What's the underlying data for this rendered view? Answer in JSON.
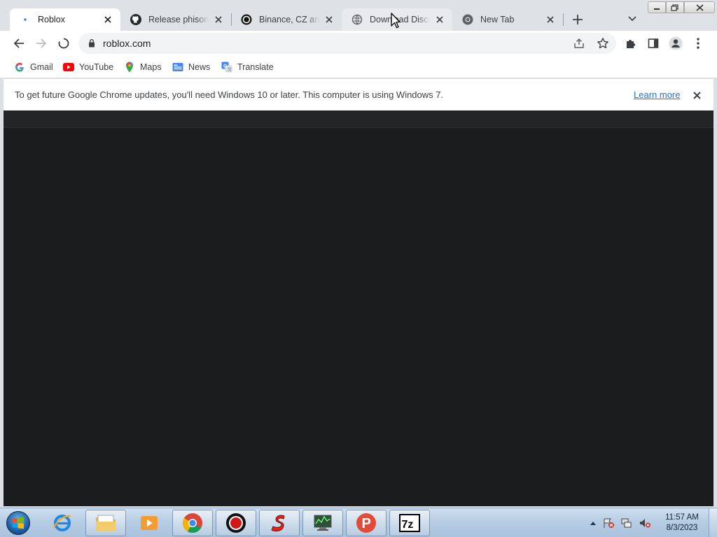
{
  "tabs": [
    {
      "title": "Roblox",
      "favicon": "loading-dot-icon",
      "active": true
    },
    {
      "title": "Release phison · T",
      "favicon": "github-icon",
      "active": false
    },
    {
      "title": "Binance, CZ and e",
      "favicon": "circle-logo-icon",
      "active": false
    },
    {
      "title": "Download Discord",
      "favicon": "globe-icon",
      "active": false
    },
    {
      "title": "New Tab",
      "favicon": "chrome-icon",
      "active": false
    }
  ],
  "toolbar": {
    "url": "roblox.com"
  },
  "bookmarks": [
    {
      "label": "Gmail",
      "icon": "google-icon"
    },
    {
      "label": "YouTube",
      "icon": "youtube-icon"
    },
    {
      "label": "Maps",
      "icon": "maps-icon"
    },
    {
      "label": "News",
      "icon": "news-icon"
    },
    {
      "label": "Translate",
      "icon": "translate-icon"
    }
  ],
  "infobar": {
    "message": "To get future Google Chrome updates, you'll need Windows 10 or later. This computer is using Windows 7.",
    "link": "Learn more"
  },
  "taskbar": {
    "apps": [
      "internet-explorer-icon",
      "file-explorer-icon",
      "media-player-icon",
      "chrome-icon",
      "recorder-icon",
      "red-s-app-icon",
      "task-manager-icon",
      "psiphon-icon",
      "7zip-icon"
    ],
    "app_texts": {
      "psiphon": "P",
      "zip": "7z"
    },
    "time": "11:57 AM",
    "date": "8/3/2023"
  },
  "colors": {
    "page_bg": "#1b1c1e",
    "tabstrip_bg": "#dee1e6",
    "link": "#1a73e8"
  }
}
